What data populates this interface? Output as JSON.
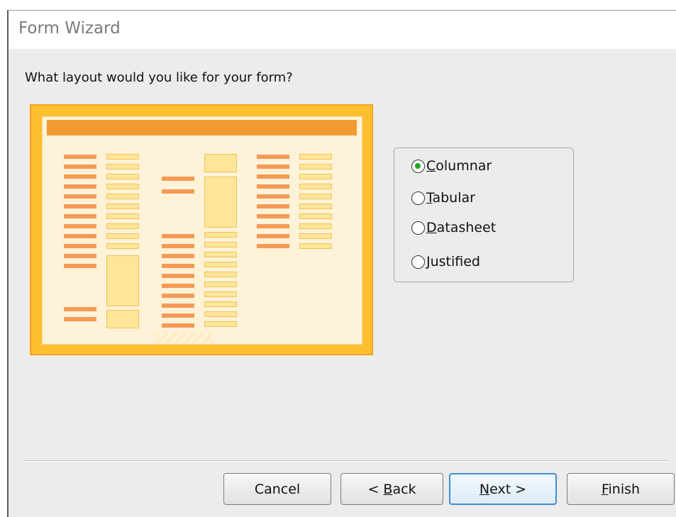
{
  "window": {
    "title": "Form Wizard"
  },
  "question": "What layout would you like for your form?",
  "layout_options": {
    "selected": "Columnar",
    "items": [
      {
        "hotkey": "C",
        "rest": "olumnar",
        "checked": true
      },
      {
        "hotkey": "T",
        "rest": "abular",
        "checked": false
      },
      {
        "hotkey": "D",
        "rest": "atasheet",
        "checked": false
      },
      {
        "hotkey": "J",
        "rest": "ustified",
        "checked": false
      }
    ]
  },
  "buttons": {
    "cancel": {
      "label": "Cancel"
    },
    "back": {
      "prefix": "< ",
      "hotkey": "B",
      "rest": "ack"
    },
    "next": {
      "hotkey": "N",
      "rest": "ext >"
    },
    "finish": {
      "hotkey": "F",
      "rest": "inish"
    }
  },
  "colors": {
    "preview_frame": "#fdbf2e",
    "preview_header": "#f49a33",
    "label_bar": "#f59a55",
    "field_box": "#fde69a",
    "selected_radio": "#22aa22",
    "default_button_border": "#3d8fd4"
  }
}
